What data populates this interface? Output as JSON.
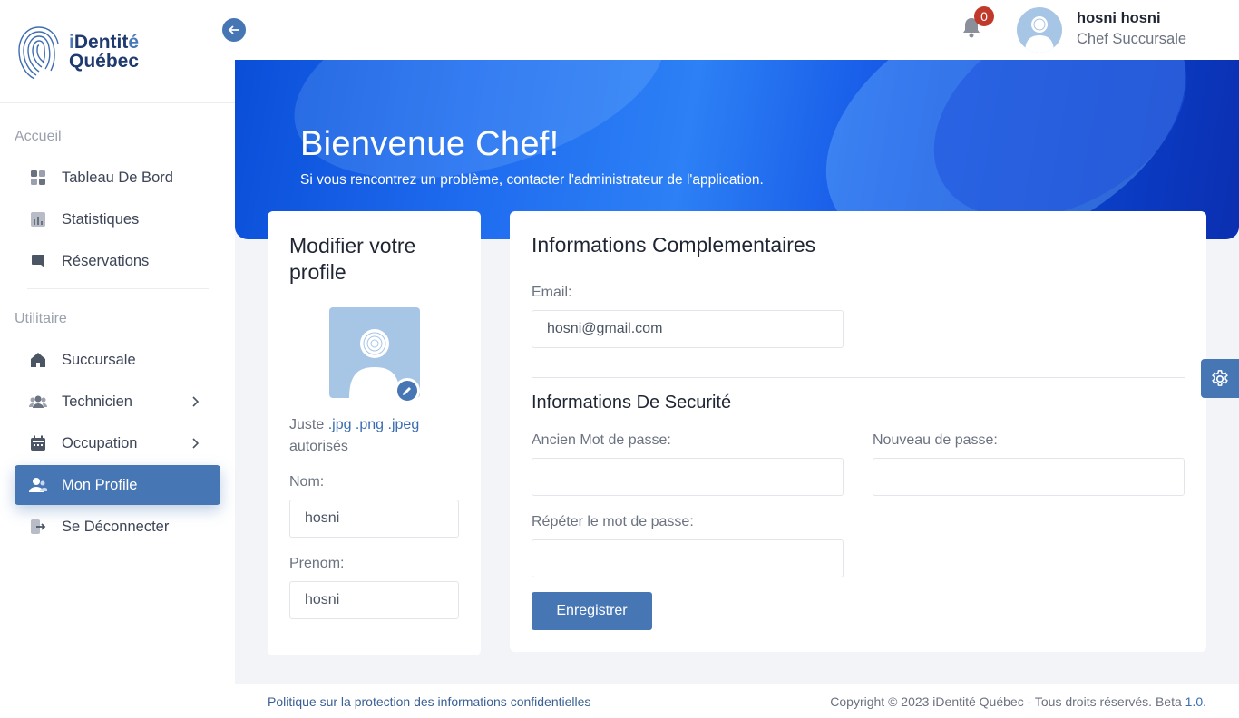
{
  "brand": {
    "line1_i": "i",
    "line1_rest": "Dentit",
    "line1_accent": "é",
    "line2": "Québec"
  },
  "sidebar": {
    "sections": [
      {
        "label": "Accueil"
      },
      {
        "label": "Utilitaire"
      }
    ],
    "items": [
      {
        "label": "Tableau De Bord",
        "icon": "dashboard-icon"
      },
      {
        "label": "Statistiques",
        "icon": "chart-icon"
      },
      {
        "label": "Réservations",
        "icon": "bookmark-icon"
      },
      {
        "label": "Succursale",
        "icon": "home-icon"
      },
      {
        "label": "Technicien",
        "icon": "users-icon"
      },
      {
        "label": "Occupation",
        "icon": "calendar-icon"
      },
      {
        "label": "Mon Profile",
        "icon": "user-icon",
        "active": true
      },
      {
        "label": "Se Déconnecter",
        "icon": "logout-icon"
      }
    ]
  },
  "topbar": {
    "notification_count": "0",
    "user_name": "hosni hosni",
    "user_role": "Chef Succursale"
  },
  "banner": {
    "title": "Bienvenue Chef!",
    "subtitle": "Si vous rencontrez un problème, contacter l'administrateur de l'application."
  },
  "profile_card": {
    "title": "Modifier votre profile",
    "hint_prefix": "Juste ",
    "hint_ext": ".jpg .png .jpeg",
    "hint_suffix": "autorisés",
    "nom_label": "Nom:",
    "nom_value": "hosni",
    "prenom_label": "Prenom:",
    "prenom_value": "hosni"
  },
  "info_card": {
    "title": "Informations Complementaires",
    "email_label": "Email:",
    "email_value": "hosni@gmail.com",
    "security_title": "Informations De Securité",
    "old_pw_label": "Ancien Mot de passe:",
    "new_pw_label": "Nouveau de passe:",
    "repeat_pw_label": "Répéter le mot de passe:",
    "save_label": "Enregistrer"
  },
  "footer": {
    "privacy_link": "Politique sur la protection des informations confidentielles",
    "copyright": "Copyright © 2023 iDentité Québec - Tous droits réservés. Beta ",
    "version": "1.0."
  },
  "colors": {
    "accent": "#4776b5",
    "badge": "#c0392b",
    "banner": "#1f6cf0"
  }
}
